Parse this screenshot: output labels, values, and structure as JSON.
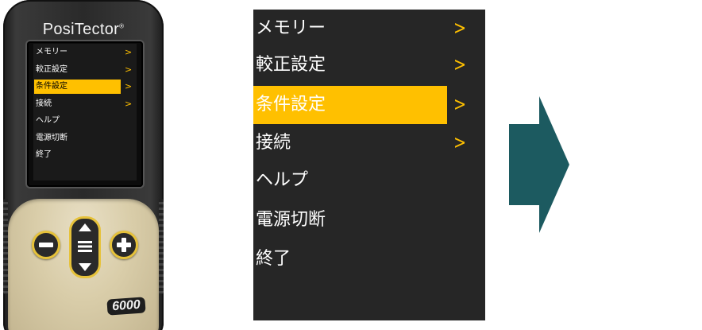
{
  "device": {
    "brand": "PosiTector",
    "brand_mark": "®",
    "model": "6000",
    "screen_menu": [
      {
        "label": "メモリー",
        "has_submenu": true,
        "selected": false,
        "chevron": ">"
      },
      {
        "label": "較正設定",
        "has_submenu": true,
        "selected": false,
        "chevron": ">"
      },
      {
        "label": "条件設定",
        "has_submenu": true,
        "selected": true,
        "chevron": ">"
      },
      {
        "label": "接続",
        "has_submenu": true,
        "selected": false,
        "chevron": ">"
      },
      {
        "label": "ヘルプ",
        "has_submenu": false,
        "selected": false
      },
      {
        "label": "電源切断",
        "has_submenu": false,
        "selected": false
      },
      {
        "label": "終了",
        "has_submenu": false,
        "selected": false
      }
    ],
    "buttons": [
      {
        "name": "minus",
        "icon": "minus-icon"
      },
      {
        "name": "menu",
        "icon": "menu-lines-icon"
      },
      {
        "name": "plus",
        "icon": "plus-icon"
      }
    ]
  },
  "menu": {
    "items": [
      {
        "label": "メモリー",
        "has_submenu": true,
        "selected": false,
        "chevron": ">"
      },
      {
        "label": "較正設定",
        "has_submenu": true,
        "selected": false,
        "chevron": ">"
      },
      {
        "label": "条件設定",
        "has_submenu": true,
        "selected": true,
        "chevron": ">"
      },
      {
        "label": "接続",
        "has_submenu": true,
        "selected": false,
        "chevron": ">"
      },
      {
        "label": "ヘルプ",
        "has_submenu": false,
        "selected": false
      },
      {
        "label": "電源切断",
        "has_submenu": false,
        "selected": false
      },
      {
        "label": "終了",
        "has_submenu": false,
        "selected": false
      }
    ]
  },
  "colors": {
    "highlight": "#ffc000",
    "menu_background": "#262626",
    "menu_text": "#ffffff",
    "arrow": "#1c5a60",
    "button_ring": "#e6c23a",
    "shell": "#d9cda9"
  },
  "arrow_icon": "right-arrow-icon"
}
